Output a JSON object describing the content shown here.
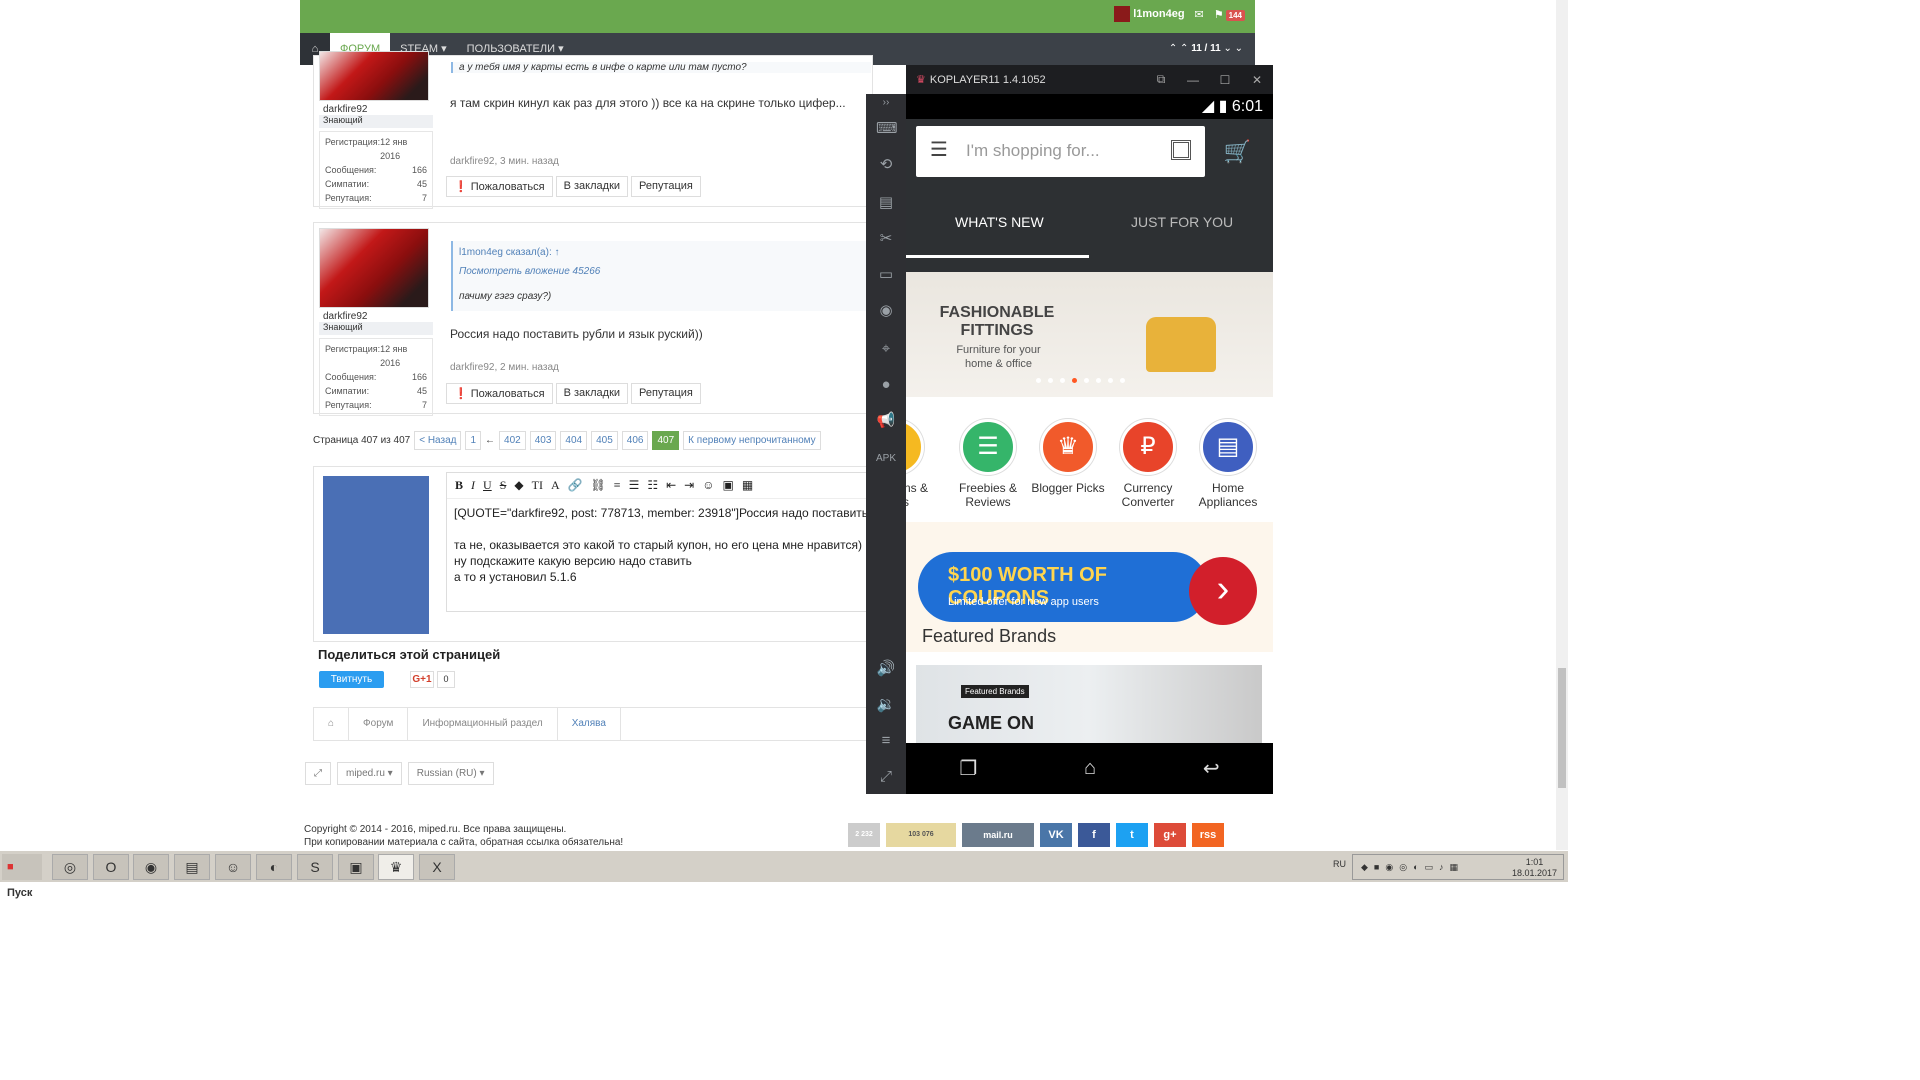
{
  "header": {
    "username": "l1mon4eg",
    "notif_count": "144",
    "nav_items": [
      "ФОРУМ",
      "STEAM ▾",
      "ПОЛЬЗОВАТЕЛИ ▾"
    ],
    "pager": "11 / 11"
  },
  "posts": [
    {
      "quote_text": "а у тебя имя у карты есть в инфе о карте или там пусто?",
      "username": "darkfire92",
      "rank": "Знающий",
      "stats": [
        [
          "Регистрация:",
          "12 янв 2016"
        ],
        [
          "Сообщения:",
          "166"
        ],
        [
          "Симпатии:",
          "45"
        ],
        [
          "Репутация:",
          "7"
        ]
      ],
      "message": "я там скрин кинул как раз для этого )) все ка на скрине только цифер...",
      "meta": "darkfire92, 3 мин. назад",
      "buttons": [
        "Пожаловаться",
        "В закладки",
        "Репутация"
      ]
    },
    {
      "quote_author": "l1mon4eg сказал(а): ↑",
      "quote_link": "Посмотреть вложение 45266",
      "quote_text": "пачиму гэгэ сразу?)",
      "username": "darkfire92",
      "rank": "Знающий",
      "stats": [
        [
          "Регистрация:",
          "12 янв 2016"
        ],
        [
          "Сообщения:",
          "166"
        ],
        [
          "Симпатии:",
          "45"
        ],
        [
          "Репутация:",
          "7"
        ]
      ],
      "message": "Россия надо поставить рубли и язык руский))",
      "meta": "darkfire92, 2 мин. назад",
      "buttons": [
        "Пожаловаться",
        "В закладки",
        "Репутация"
      ]
    }
  ],
  "pagination": {
    "label": "Страница 407 из 407",
    "prev": "< Назад",
    "pages": [
      "1",
      "←",
      "402",
      "403",
      "404",
      "405",
      "406",
      "407"
    ],
    "current": "407",
    "first_unread": "К первому непрочитанному"
  },
  "editor": {
    "toolbar": [
      "B",
      "I",
      "U",
      "S",
      "◆",
      "TI",
      "A",
      "🔗",
      "⛓",
      "≡",
      "☰",
      "☷",
      "⇤",
      "⇥",
      "☺",
      "▣",
      "▦"
    ],
    "lines": [
      "[QUOTE=\"darkfire92, post: 778713, member: 23918\"]Россия надо поставить",
      "",
      "та не, оказывается это какой то старый купон, но его цена мне нравится)",
      "ну подскажите какую версию надо ставить",
      "а то я установил 5.1.6"
    ]
  },
  "share": {
    "title": "Поделиться этой страницей",
    "tweet": "Твитнуть",
    "gplus": "G+1",
    "gplus_count": "0"
  },
  "breadcrumb": [
    "Форум",
    "Информационный раздел",
    "Халява"
  ],
  "footer": {
    "selects": [
      "miped.ru ▾",
      "Russian (RU) ▾"
    ],
    "copyright_1": "Copyright © 2014 - 2016, miped.ru. Все права защищены.",
    "copyright_2": "При копировании материала с сайта, обратная ссылка обязательна!",
    "icons": [
      "2 232",
      "103 076",
      "mail.ru",
      "VK",
      "f",
      "t",
      "g+",
      "rss"
    ]
  },
  "emulator": {
    "title": "KOPLAYER11 1.4.1052",
    "time": "6:01",
    "search_placeholder": "I'm shopping for...",
    "tabs": [
      "WHAT'S NEW",
      "JUST FOR YOU"
    ],
    "banner_title": "FASHIONABLE FITTINGS",
    "banner_sub": "Furniture for your home & office",
    "categories": [
      {
        "label": "ns & pons",
        "color": "#f5b921"
      },
      {
        "label": "Freebies & Reviews",
        "color": "#35b56a"
      },
      {
        "label": "Blogger Picks",
        "color": "#f15a2b"
      },
      {
        "label": "Currency Converter",
        "color": "#e8442a"
      },
      {
        "label": "Home Appliances",
        "color": "#3f5fc0"
      }
    ],
    "coupon_big": "$100 WORTH OF COUPONS",
    "coupon_sub": "Limited offer for new app users",
    "featured_title": "Featured Brands",
    "gameon": "GAME ON",
    "gameon_tag": "Featured Brands"
  },
  "taskbar": {
    "start": "Пуск",
    "lang": "RU",
    "time": "1:01",
    "date": "18.01.2017"
  }
}
